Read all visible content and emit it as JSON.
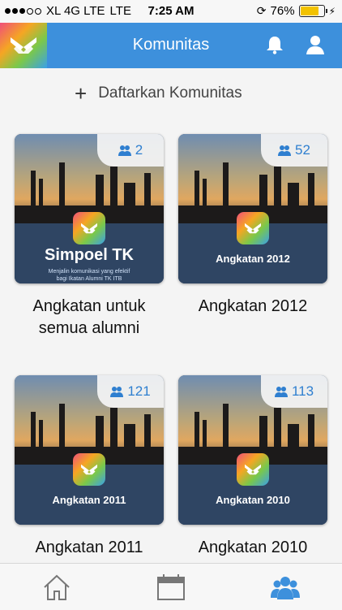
{
  "status_bar": {
    "carrier": "XL 4G LTE",
    "network": "LTE",
    "time": "7:25 AM",
    "battery": "76%",
    "battery_level": 0.76
  },
  "header": {
    "title": "Komunitas",
    "icons": [
      "app-logo-icon",
      "bell-icon",
      "user-icon"
    ]
  },
  "register": {
    "icon": "plus-icon",
    "label": "Daftarkan Komunitas"
  },
  "communities": [
    {
      "members": "2",
      "card_title": "Simpoel TK",
      "card_subtitle_1": "Menjalin komunikasi yang efektif",
      "card_subtitle_2": "bagi Ikatan Alumni TK ITB",
      "label": "Angkatan untuk semua alumni"
    },
    {
      "members": "52",
      "card_title": "Angkatan 2012",
      "label": "Angkatan 2012"
    },
    {
      "members": "121",
      "card_title": "Angkatan 2011",
      "label": "Angkatan 2011"
    },
    {
      "members": "113",
      "card_title": "Angkatan 2010",
      "label": "Angkatan 2010"
    }
  ],
  "tab_bar": {
    "tabs": [
      "home-icon",
      "calendar-icon",
      "community-icon"
    ],
    "active": "community-icon",
    "colors": {
      "active": "#3d90dc",
      "inactive": "#777777"
    }
  },
  "colors": {
    "header": "#3d90dc",
    "badge_text": "#2f7fd0"
  }
}
